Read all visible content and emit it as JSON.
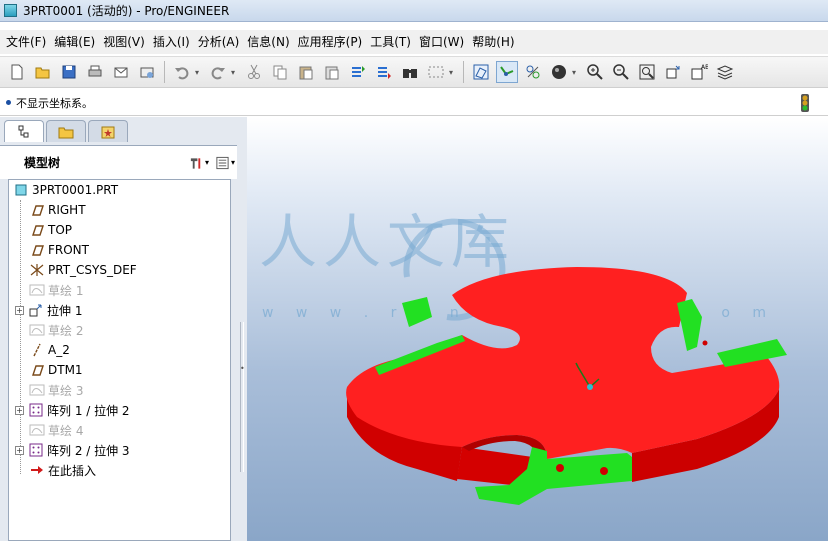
{
  "window": {
    "title": "3PRT0001 (活动的) - Pro/ENGINEER"
  },
  "menu": [
    "文件(F)",
    "编辑(E)",
    "视图(V)",
    "插入(I)",
    "分析(A)",
    "信息(N)",
    "应用程序(P)",
    "工具(T)",
    "窗口(W)",
    "帮助(H)"
  ],
  "message": {
    "text": "不显示坐标系。"
  },
  "model_tree": {
    "title": "模型树",
    "items": [
      {
        "label": "3PRT0001.PRT",
        "icon": "part-icon",
        "dim": false,
        "expandable": false
      },
      {
        "label": "RIGHT",
        "icon": "datum-plane-icon",
        "dim": false,
        "expandable": false
      },
      {
        "label": "TOP",
        "icon": "datum-plane-icon",
        "dim": false,
        "expandable": false
      },
      {
        "label": "FRONT",
        "icon": "datum-plane-icon",
        "dim": false,
        "expandable": false
      },
      {
        "label": "PRT_CSYS_DEF",
        "icon": "csys-icon",
        "dim": false,
        "expandable": false
      },
      {
        "label": "草绘 1",
        "icon": "sketch-icon",
        "dim": true,
        "expandable": false
      },
      {
        "label": "拉伸 1",
        "icon": "extrude-icon",
        "dim": false,
        "expandable": true
      },
      {
        "label": "草绘 2",
        "icon": "sketch-icon",
        "dim": true,
        "expandable": false
      },
      {
        "label": "A_2",
        "icon": "datum-axis-icon",
        "dim": false,
        "expandable": false
      },
      {
        "label": "DTM1",
        "icon": "datum-plane-icon",
        "dim": false,
        "expandable": false
      },
      {
        "label": "草绘 3",
        "icon": "sketch-icon",
        "dim": true,
        "expandable": false
      },
      {
        "label": "阵列 1 / 拉伸 2",
        "icon": "pattern-icon",
        "dim": false,
        "expandable": true
      },
      {
        "label": "草绘 4",
        "icon": "sketch-icon",
        "dim": true,
        "expandable": false
      },
      {
        "label": "阵列 2 / 拉伸 3",
        "icon": "pattern-icon",
        "dim": false,
        "expandable": true
      },
      {
        "label": "在此插入",
        "icon": "insert-here-arrow-icon",
        "dim": false,
        "expandable": false
      }
    ]
  },
  "watermark": {
    "text": "人人文库",
    "url": "w w w . r e n r e n d o c . c o m"
  },
  "colors": {
    "part": "#ff2020",
    "part_side": "#d00000",
    "feature": "#22e022"
  }
}
